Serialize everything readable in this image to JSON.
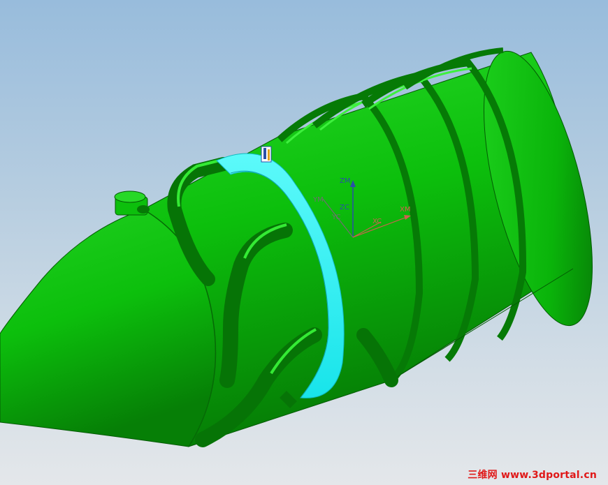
{
  "viewport": {
    "background_top": "#98bcdc",
    "background_bottom": "#e4e7ea",
    "part_color": "#0dbf0d",
    "selection_ring_color": "#22f0f0"
  },
  "triad": {
    "labels": {
      "zm": "ZM",
      "ym": "YM",
      "zc": "ZC",
      "yc": "YC",
      "xm": "XM",
      "xc": "XC"
    },
    "colors": {
      "z_axis": "#2a4fa8",
      "y_axis": "#6f6f6f",
      "x_axis": "#d06050"
    }
  },
  "watermark": {
    "cn_text": "三维网",
    "url_text": "www.3dportal.cn",
    "color": "#e01818"
  }
}
